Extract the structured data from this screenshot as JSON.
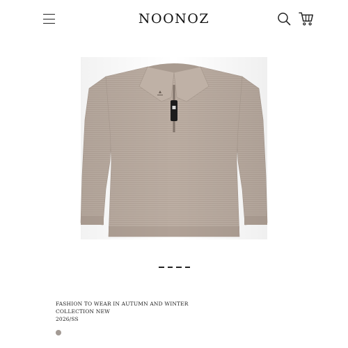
{
  "header": {
    "brand": "NOONOZ",
    "icons": [
      "menu-icon",
      "search-icon",
      "cart-icon"
    ]
  },
  "product": {
    "image": "taupe knit long-sleeve half-zip polo sweater",
    "colors": {
      "body": "#bdafa4",
      "shadow": "#a89a8f",
      "zipper": "#1c1c1c"
    }
  },
  "carousel": {
    "count": 4,
    "active": 1
  },
  "description": {
    "line1": "FASHION TO WEAR IN AUTUMN AND WINTER",
    "line2": "COLLECTION NEW",
    "line3": "2026/SS"
  },
  "swatch": {
    "color": "#a39a94"
  }
}
